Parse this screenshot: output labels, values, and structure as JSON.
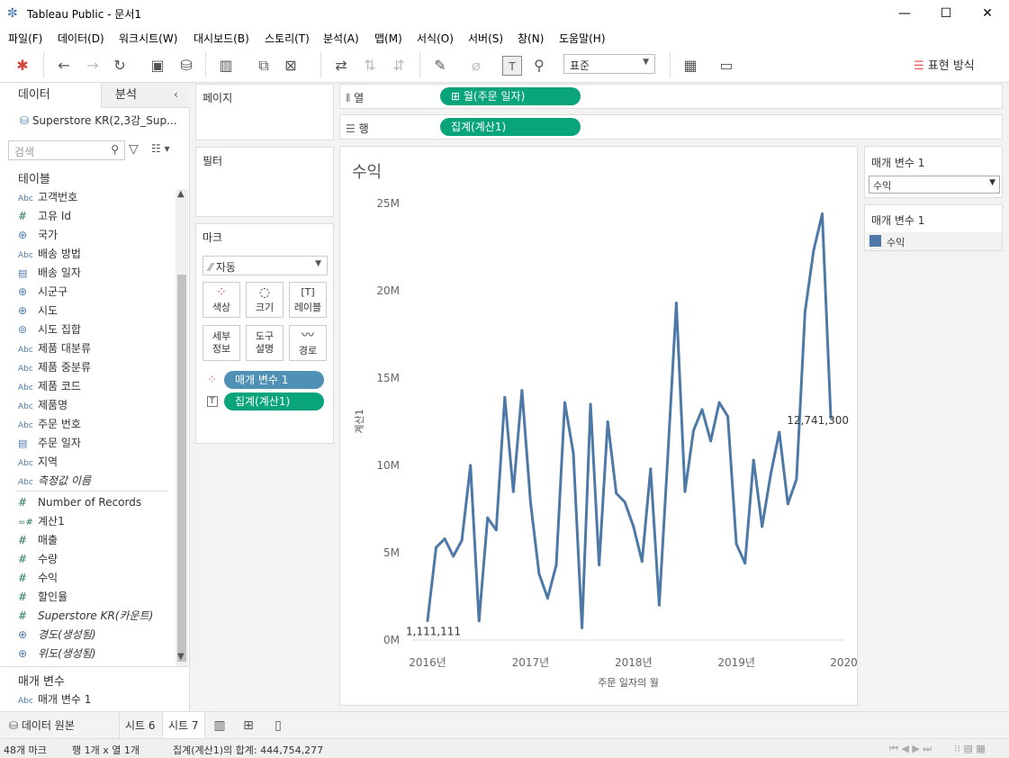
{
  "window": {
    "title": "Tableau Public - 문서1",
    "minimize": "—",
    "maximize": "☐",
    "close": "✕"
  },
  "menu": [
    "파일(F)",
    "데이터(D)",
    "워크시트(W)",
    "대시보드(B)",
    "스토리(T)",
    "분석(A)",
    "맵(M)",
    "서식(O)",
    "서버(S)",
    "창(N)",
    "도움말(H)"
  ],
  "toolbar": {
    "fit_value": "표준",
    "show_me_label": "표현 방식"
  },
  "data_pane": {
    "tab_data": "데이터",
    "tab_analysis": "분석",
    "datasource": "Superstore KR(2,3강_Sup...",
    "search_placeholder": "검색",
    "tables_heading": "테이블",
    "fields": [
      {
        "type": "Abc",
        "name": "고객번호"
      },
      {
        "type": "#",
        "name": "고유 Id"
      },
      {
        "type": "geo",
        "name": "국가"
      },
      {
        "type": "Abc",
        "name": "배송 방법"
      },
      {
        "type": "date",
        "name": "배송 일자"
      },
      {
        "type": "geo",
        "name": "시군구"
      },
      {
        "type": "geo",
        "name": "시도"
      },
      {
        "type": "set",
        "name": "시도 집합"
      },
      {
        "type": "Abc",
        "name": "제품 대분류"
      },
      {
        "type": "Abc",
        "name": "제품 중분류"
      },
      {
        "type": "Abc",
        "name": "제품 코드"
      },
      {
        "type": "Abc",
        "name": "제품명"
      },
      {
        "type": "Abc",
        "name": "주문 번호"
      },
      {
        "type": "date",
        "name": "주문 일자"
      },
      {
        "type": "Abc",
        "name": "지역"
      },
      {
        "type": "Abc",
        "name": "측정값 이름"
      }
    ],
    "measures": [
      {
        "type": "#",
        "name": "Number of Records"
      },
      {
        "type": "calc",
        "name": "계산1"
      },
      {
        "type": "#",
        "name": "매출"
      },
      {
        "type": "#",
        "name": "수량"
      },
      {
        "type": "#",
        "name": "수익"
      },
      {
        "type": "#",
        "name": "할인율"
      },
      {
        "type": "#",
        "name": "Superstore KR(카운트)"
      },
      {
        "type": "geo",
        "name": "경도(생성됨)"
      },
      {
        "type": "geo",
        "name": "위도(생성됨)"
      }
    ],
    "params_heading": "매개 변수",
    "params": [
      {
        "type": "Abc",
        "name": "매개 변수 1"
      }
    ]
  },
  "cards": {
    "pages": "페이지",
    "filters": "필터",
    "marks": "마크",
    "mark_type": "자동",
    "mark_buttons": {
      "color": "색상",
      "size": "크기",
      "label": "레이블",
      "detail_1": "세부",
      "detail_2": "정보",
      "tooltip_1": "도구",
      "tooltip_2": "설명",
      "path": "경로"
    },
    "mark_pills": {
      "color_pill": "매개 변수 1",
      "label_pill": "집계(계산1)"
    }
  },
  "shelves": {
    "columns_label": "열",
    "rows_label": "행",
    "columns_pill": "⊞ 월(주문 일자)",
    "rows_pill": "집계(계산1)"
  },
  "view": {
    "title": "수익"
  },
  "right": {
    "param_title": "매개 변수 1",
    "param_value": "수익",
    "legend_title": "매개 변수 1",
    "legend_item": "수익",
    "legend_color": "#4e79a7"
  },
  "tabs": {
    "datasource": "데이터 원본",
    "sheets": [
      "시트 6",
      "시트 7"
    ]
  },
  "status": {
    "marks": "48개 마크",
    "rows_cols": "행 1개 x 열 1개",
    "sum": "집계(계산1)의 합계: 444,754,277"
  },
  "chart_data": {
    "type": "line",
    "title": "수익",
    "xlabel": "주문 일자의 월",
    "ylabel": "계산1",
    "x_ticks": [
      "2016년",
      "2017년",
      "2018년",
      "2019년",
      "2020년"
    ],
    "y_ticks": [
      "0M",
      "5M",
      "10M",
      "15M",
      "20M",
      "25M"
    ],
    "ylim": [
      0,
      25000000
    ],
    "color": "#4e79a7",
    "series": [
      {
        "values": [
          1111111,
          5300000,
          5800000,
          4800000,
          5700000,
          10000000,
          1100000,
          7000000,
          6300000,
          13900000,
          8500000,
          14300000,
          7900000,
          3800000,
          2400000,
          4300000,
          13600000,
          10700000,
          700000,
          13500000,
          4300000,
          12500000,
          8400000,
          7900000,
          6500000,
          4500000,
          9800000,
          2000000,
          10500000,
          19300000,
          8500000,
          12000000,
          13200000,
          11400000,
          13600000,
          12800000,
          5500000,
          4400000,
          10300000,
          6500000,
          9500000,
          11900000,
          7800000,
          9200000,
          18800000,
          22300000,
          24400000,
          12741300
        ]
      }
    ],
    "data_labels": [
      {
        "index": 0,
        "text": "1,111,111"
      },
      {
        "index": 47,
        "text": "12,741,300"
      }
    ]
  }
}
